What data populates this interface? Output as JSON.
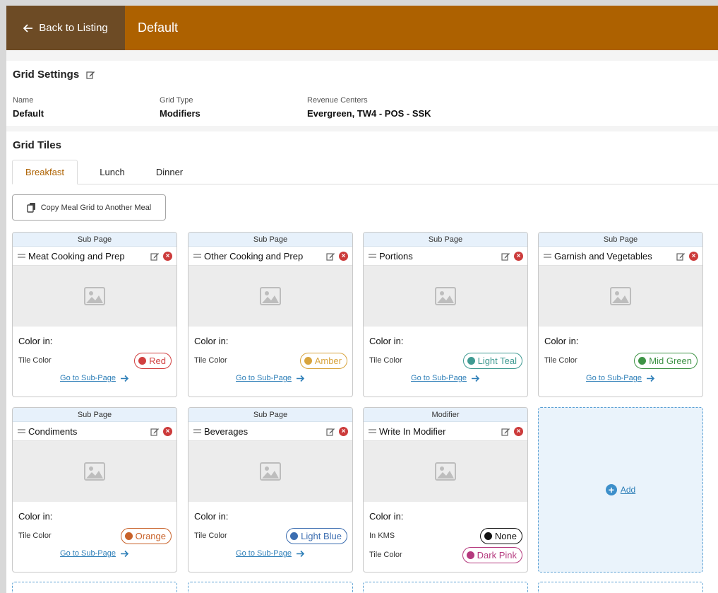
{
  "header": {
    "back_label": "Back to Listing",
    "title": "Default",
    "accent": "#ad6100",
    "back_bg": "#6d4b25"
  },
  "grid_settings": {
    "title": "Grid Settings",
    "fields": [
      {
        "label": "Name",
        "value": "Default"
      },
      {
        "label": "Grid Type",
        "value": "Modifiers"
      },
      {
        "label": "Revenue Centers",
        "value": "Evergreen, TW4 - POS - SSK"
      }
    ]
  },
  "grid_tiles": {
    "title": "Grid Tiles",
    "tabs": [
      {
        "label": "Breakfast",
        "active": true
      },
      {
        "label": "Lunch",
        "active": false
      },
      {
        "label": "Dinner",
        "active": false
      }
    ],
    "copy_button": "Copy Meal Grid to Another Meal",
    "tiles": [
      {
        "type": "Sub Page",
        "name": "Meat Cooking and Prep",
        "color_heading": "Color in:",
        "rows": [
          {
            "label": "Tile Color",
            "color": "Red",
            "hex": "#d13f3f"
          }
        ],
        "link": "Go to Sub-Page"
      },
      {
        "type": "Sub Page",
        "name": "Other Cooking and Prep",
        "color_heading": "Color in:",
        "rows": [
          {
            "label": "Tile Color",
            "color": "Amber",
            "hex": "#d8a43d"
          }
        ],
        "link": "Go to Sub-Page"
      },
      {
        "type": "Sub Page",
        "name": "Portions",
        "color_heading": "Color in:",
        "rows": [
          {
            "label": "Tile Color",
            "color": "Light Teal",
            "hex": "#3f9a92"
          }
        ],
        "link": "Go to Sub-Page"
      },
      {
        "type": "Sub Page",
        "name": "Garnish and Vegetables",
        "color_heading": "Color in:",
        "rows": [
          {
            "label": "Tile Color",
            "color": "Mid Green",
            "hex": "#3e9345"
          }
        ],
        "link": "Go to Sub-Page"
      },
      {
        "type": "Sub Page",
        "name": "Condiments",
        "color_heading": "Color in:",
        "rows": [
          {
            "label": "Tile Color",
            "color": "Orange",
            "hex": "#c8622a"
          }
        ],
        "link": "Go to Sub-Page"
      },
      {
        "type": "Sub Page",
        "name": "Beverages",
        "color_heading": "Color in:",
        "rows": [
          {
            "label": "Tile Color",
            "color": "Light Blue",
            "hex": "#3b6db0"
          }
        ],
        "link": "Go to Sub-Page"
      },
      {
        "type": "Modifier",
        "name": "Write In Modifier",
        "color_heading": "Color in:",
        "rows": [
          {
            "label": "In KMS",
            "color": "None",
            "hex": "#111111"
          },
          {
            "label": "Tile Color",
            "color": "Dark Pink",
            "hex": "#b53a7e"
          }
        ],
        "link": ""
      }
    ],
    "add_label": "Add"
  },
  "icons": [
    "arrow-left-icon",
    "edit-icon",
    "delete-icon",
    "drag-handle-icon",
    "image-placeholder-icon",
    "copy-icon",
    "arrow-right-icon",
    "plus-icon"
  ]
}
